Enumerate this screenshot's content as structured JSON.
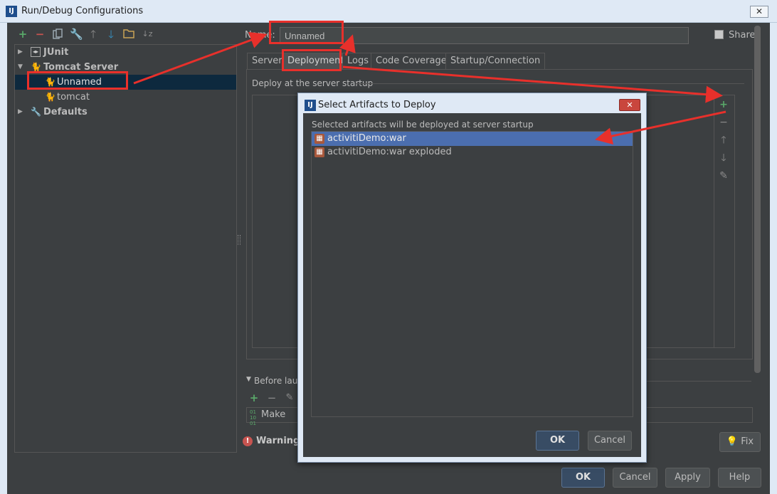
{
  "window": {
    "title": "Run/Debug Configurations",
    "close_glyph": "✕"
  },
  "toolbar": {
    "icons": [
      "add-icon",
      "remove-icon",
      "copy-icon",
      "edit-defaults-icon",
      "move-up-icon",
      "move-down-icon",
      "folder-icon",
      "sort-icon"
    ],
    "add": "+",
    "remove": "−",
    "up": "🡑",
    "down": "🡓",
    "sort": "↓z"
  },
  "tree": {
    "items": [
      {
        "label": "JUnit",
        "icon": "junit-icon",
        "expand": "▶"
      },
      {
        "label": "Tomcat Server",
        "icon": "tomcat-icon",
        "expand": "▼"
      },
      {
        "label": "Unnamed",
        "icon": "tomcat-icon"
      },
      {
        "label": "tomcat",
        "icon": "tomcat-icon"
      },
      {
        "label": "Defaults",
        "icon": "wrench-icon",
        "expand": "▶"
      }
    ]
  },
  "config": {
    "name_label": "Name:",
    "name_value": "Unnamed",
    "share_label": "Share"
  },
  "tabs": [
    {
      "label": "Server"
    },
    {
      "label": "Deployment"
    },
    {
      "label": "Logs"
    },
    {
      "label": "Code Coverage"
    },
    {
      "label": "Startup/Connection"
    }
  ],
  "deployment": {
    "section_label": "Deploy at the server startup",
    "side_buttons": {
      "add": "+",
      "remove": "−",
      "up": "🡑",
      "down": "🡓",
      "edit": "✎"
    }
  },
  "before_launch": {
    "label": "Before laun",
    "make_label": "Make",
    "make_icon": "01\n10"
  },
  "warning": {
    "label": "Warning:",
    "fix_label": "Fix"
  },
  "buttons": {
    "ok": "OK",
    "cancel": "Cancel",
    "apply": "Apply",
    "help": "Help"
  },
  "dialog": {
    "title": "Select Artifacts to Deploy",
    "close_glyph": "✕",
    "hint": "Selected artifacts will be deployed at server startup",
    "artifacts": [
      {
        "label": "activitiDemo:war",
        "selected": true
      },
      {
        "label": "activitiDemo:war exploded",
        "selected": false
      }
    ],
    "ok": "OK",
    "cancel": "Cancel"
  },
  "colors": {
    "annotation_red": "#e8302b",
    "selection_blue": "#4b6eaf",
    "panel_bg": "#3c3f41"
  }
}
